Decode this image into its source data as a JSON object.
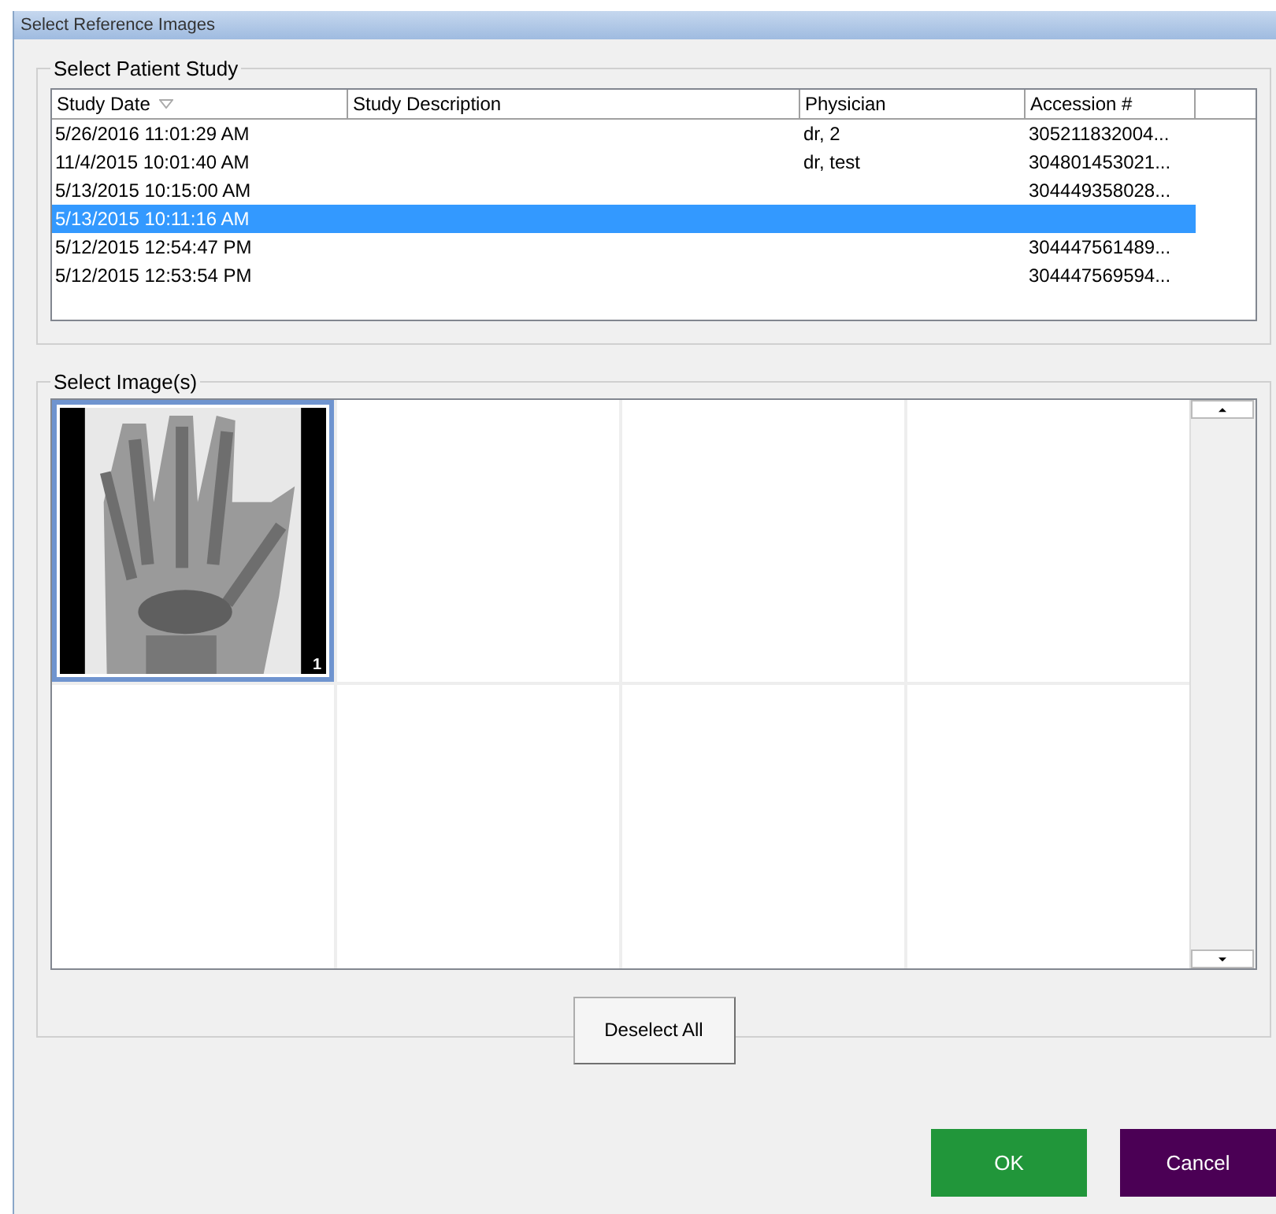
{
  "window": {
    "title": "Select Reference Images"
  },
  "study_group": {
    "title": "Select Patient Study"
  },
  "table": {
    "columns": [
      {
        "label": "Study Date",
        "sorted": true
      },
      {
        "label": "Study Description",
        "sorted": false
      },
      {
        "label": "Physician",
        "sorted": false
      },
      {
        "label": "Accession #",
        "sorted": false
      }
    ],
    "rows": [
      {
        "cells": [
          "5/26/2016 11:01:29 AM",
          "",
          "dr, 2",
          "305211832004..."
        ],
        "selected": false
      },
      {
        "cells": [
          "11/4/2015 10:01:40 AM",
          "",
          "dr, test",
          "304801453021..."
        ],
        "selected": false
      },
      {
        "cells": [
          "5/13/2015 10:15:00 AM",
          "",
          "",
          "304449358028..."
        ],
        "selected": false
      },
      {
        "cells": [
          "5/13/2015 10:11:16 AM",
          "",
          "",
          ""
        ],
        "selected": true
      },
      {
        "cells": [
          "5/12/2015 12:54:47 PM",
          "",
          "",
          "304447561489..."
        ],
        "selected": false
      },
      {
        "cells": [
          "5/12/2015 12:53:54 PM",
          "",
          "",
          "304447569594..."
        ],
        "selected": false
      }
    ]
  },
  "image_group": {
    "title": "Select Image(s)",
    "cells": [
      {
        "kind": "picture",
        "selected": true,
        "index": "1"
      },
      {
        "kind": "empty"
      },
      {
        "kind": "empty"
      },
      {
        "kind": "empty"
      },
      {
        "kind": "empty"
      },
      {
        "kind": "empty"
      },
      {
        "kind": "empty"
      },
      {
        "kind": "empty"
      }
    ],
    "deselect_button": "Deselect All"
  },
  "buttons": [
    {
      "label": "OK",
      "color": "#21963a"
    },
    {
      "label": "Cancel",
      "color": "#4b0055"
    }
  ]
}
